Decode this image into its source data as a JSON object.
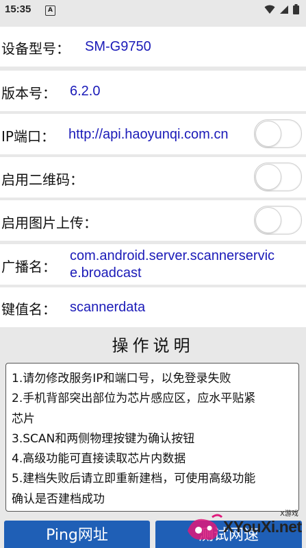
{
  "status_bar": {
    "time": "15:35",
    "notification_letter": "A"
  },
  "rows": [
    {
      "label": "设备型号：",
      "value": "SM-G9750",
      "has_toggle": false
    },
    {
      "label": "版本号：",
      "value": "6.2.0",
      "has_toggle": false
    },
    {
      "label": "IP端口：",
      "value": "http://api.haoyunqi.com.cn",
      "has_toggle": true,
      "toggle_on": false
    },
    {
      "label": "启用二维码：",
      "value": "",
      "has_toggle": true,
      "toggle_on": false
    },
    {
      "label": "启用图片上传：",
      "value": "",
      "has_toggle": true,
      "toggle_on": false
    },
    {
      "label": "广播名：",
      "value_line1": "com.android.server.scannerservic",
      "value_line2": "e.broadcast",
      "has_toggle": false
    },
    {
      "label": "键值名：",
      "value": "scannerdata",
      "has_toggle": false
    }
  ],
  "instructions": {
    "title": "操作说明",
    "lines": [
      "1.请勿修改服务IP和端口号，以免登录失败",
      "2.手机背部突出部位为芯片感应区，应水平贴紧",
      "芯片",
      "3.SCAN和两侧物理按键为确认按钮",
      "4.高级功能可直接读取芯片内数据",
      "5.建档失败后请立即重新建档，可使用高级功能",
      "确认是否建档成功"
    ]
  },
  "buttons": {
    "ping_label": "Ping网址",
    "test_label": "测试网速"
  },
  "watermark": {
    "text": "XYouXi.net",
    "small": "X游戏"
  },
  "colors": {
    "value_blue": "#1a1ab8",
    "button_blue": "#1f5fb6",
    "background": "#e8e8e8"
  }
}
